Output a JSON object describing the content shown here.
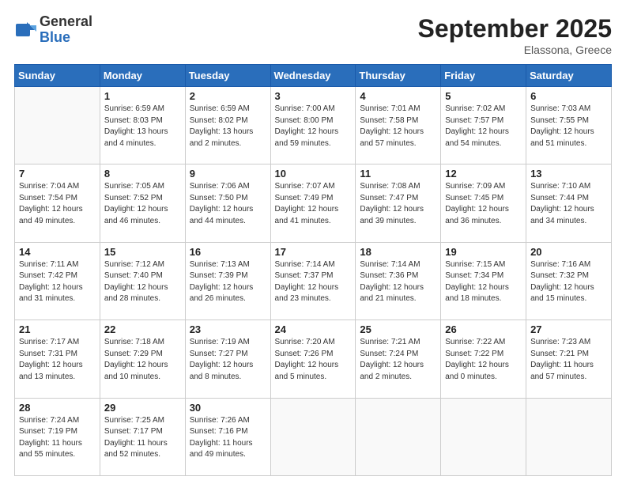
{
  "header": {
    "logo_general": "General",
    "logo_blue": "Blue",
    "month_title": "September 2025",
    "location": "Elassona, Greece"
  },
  "weekdays": [
    "Sunday",
    "Monday",
    "Tuesday",
    "Wednesday",
    "Thursday",
    "Friday",
    "Saturday"
  ],
  "weeks": [
    [
      {
        "day": "",
        "sunrise": "",
        "sunset": "",
        "daylight": ""
      },
      {
        "day": "1",
        "sunrise": "Sunrise: 6:59 AM",
        "sunset": "Sunset: 8:03 PM",
        "daylight": "Daylight: 13 hours and 4 minutes."
      },
      {
        "day": "2",
        "sunrise": "Sunrise: 6:59 AM",
        "sunset": "Sunset: 8:02 PM",
        "daylight": "Daylight: 13 hours and 2 minutes."
      },
      {
        "day": "3",
        "sunrise": "Sunrise: 7:00 AM",
        "sunset": "Sunset: 8:00 PM",
        "daylight": "Daylight: 12 hours and 59 minutes."
      },
      {
        "day": "4",
        "sunrise": "Sunrise: 7:01 AM",
        "sunset": "Sunset: 7:58 PM",
        "daylight": "Daylight: 12 hours and 57 minutes."
      },
      {
        "day": "5",
        "sunrise": "Sunrise: 7:02 AM",
        "sunset": "Sunset: 7:57 PM",
        "daylight": "Daylight: 12 hours and 54 minutes."
      },
      {
        "day": "6",
        "sunrise": "Sunrise: 7:03 AM",
        "sunset": "Sunset: 7:55 PM",
        "daylight": "Daylight: 12 hours and 51 minutes."
      }
    ],
    [
      {
        "day": "7",
        "sunrise": "Sunrise: 7:04 AM",
        "sunset": "Sunset: 7:54 PM",
        "daylight": "Daylight: 12 hours and 49 minutes."
      },
      {
        "day": "8",
        "sunrise": "Sunrise: 7:05 AM",
        "sunset": "Sunset: 7:52 PM",
        "daylight": "Daylight: 12 hours and 46 minutes."
      },
      {
        "day": "9",
        "sunrise": "Sunrise: 7:06 AM",
        "sunset": "Sunset: 7:50 PM",
        "daylight": "Daylight: 12 hours and 44 minutes."
      },
      {
        "day": "10",
        "sunrise": "Sunrise: 7:07 AM",
        "sunset": "Sunset: 7:49 PM",
        "daylight": "Daylight: 12 hours and 41 minutes."
      },
      {
        "day": "11",
        "sunrise": "Sunrise: 7:08 AM",
        "sunset": "Sunset: 7:47 PM",
        "daylight": "Daylight: 12 hours and 39 minutes."
      },
      {
        "day": "12",
        "sunrise": "Sunrise: 7:09 AM",
        "sunset": "Sunset: 7:45 PM",
        "daylight": "Daylight: 12 hours and 36 minutes."
      },
      {
        "day": "13",
        "sunrise": "Sunrise: 7:10 AM",
        "sunset": "Sunset: 7:44 PM",
        "daylight": "Daylight: 12 hours and 34 minutes."
      }
    ],
    [
      {
        "day": "14",
        "sunrise": "Sunrise: 7:11 AM",
        "sunset": "Sunset: 7:42 PM",
        "daylight": "Daylight: 12 hours and 31 minutes."
      },
      {
        "day": "15",
        "sunrise": "Sunrise: 7:12 AM",
        "sunset": "Sunset: 7:40 PM",
        "daylight": "Daylight: 12 hours and 28 minutes."
      },
      {
        "day": "16",
        "sunrise": "Sunrise: 7:13 AM",
        "sunset": "Sunset: 7:39 PM",
        "daylight": "Daylight: 12 hours and 26 minutes."
      },
      {
        "day": "17",
        "sunrise": "Sunrise: 7:14 AM",
        "sunset": "Sunset: 7:37 PM",
        "daylight": "Daylight: 12 hours and 23 minutes."
      },
      {
        "day": "18",
        "sunrise": "Sunrise: 7:14 AM",
        "sunset": "Sunset: 7:36 PM",
        "daylight": "Daylight: 12 hours and 21 minutes."
      },
      {
        "day": "19",
        "sunrise": "Sunrise: 7:15 AM",
        "sunset": "Sunset: 7:34 PM",
        "daylight": "Daylight: 12 hours and 18 minutes."
      },
      {
        "day": "20",
        "sunrise": "Sunrise: 7:16 AM",
        "sunset": "Sunset: 7:32 PM",
        "daylight": "Daylight: 12 hours and 15 minutes."
      }
    ],
    [
      {
        "day": "21",
        "sunrise": "Sunrise: 7:17 AM",
        "sunset": "Sunset: 7:31 PM",
        "daylight": "Daylight: 12 hours and 13 minutes."
      },
      {
        "day": "22",
        "sunrise": "Sunrise: 7:18 AM",
        "sunset": "Sunset: 7:29 PM",
        "daylight": "Daylight: 12 hours and 10 minutes."
      },
      {
        "day": "23",
        "sunrise": "Sunrise: 7:19 AM",
        "sunset": "Sunset: 7:27 PM",
        "daylight": "Daylight: 12 hours and 8 minutes."
      },
      {
        "day": "24",
        "sunrise": "Sunrise: 7:20 AM",
        "sunset": "Sunset: 7:26 PM",
        "daylight": "Daylight: 12 hours and 5 minutes."
      },
      {
        "day": "25",
        "sunrise": "Sunrise: 7:21 AM",
        "sunset": "Sunset: 7:24 PM",
        "daylight": "Daylight: 12 hours and 2 minutes."
      },
      {
        "day": "26",
        "sunrise": "Sunrise: 7:22 AM",
        "sunset": "Sunset: 7:22 PM",
        "daylight": "Daylight: 12 hours and 0 minutes."
      },
      {
        "day": "27",
        "sunrise": "Sunrise: 7:23 AM",
        "sunset": "Sunset: 7:21 PM",
        "daylight": "Daylight: 11 hours and 57 minutes."
      }
    ],
    [
      {
        "day": "28",
        "sunrise": "Sunrise: 7:24 AM",
        "sunset": "Sunset: 7:19 PM",
        "daylight": "Daylight: 11 hours and 55 minutes."
      },
      {
        "day": "29",
        "sunrise": "Sunrise: 7:25 AM",
        "sunset": "Sunset: 7:17 PM",
        "daylight": "Daylight: 11 hours and 52 minutes."
      },
      {
        "day": "30",
        "sunrise": "Sunrise: 7:26 AM",
        "sunset": "Sunset: 7:16 PM",
        "daylight": "Daylight: 11 hours and 49 minutes."
      },
      {
        "day": "",
        "sunrise": "",
        "sunset": "",
        "daylight": ""
      },
      {
        "day": "",
        "sunrise": "",
        "sunset": "",
        "daylight": ""
      },
      {
        "day": "",
        "sunrise": "",
        "sunset": "",
        "daylight": ""
      },
      {
        "day": "",
        "sunrise": "",
        "sunset": "",
        "daylight": ""
      }
    ]
  ]
}
